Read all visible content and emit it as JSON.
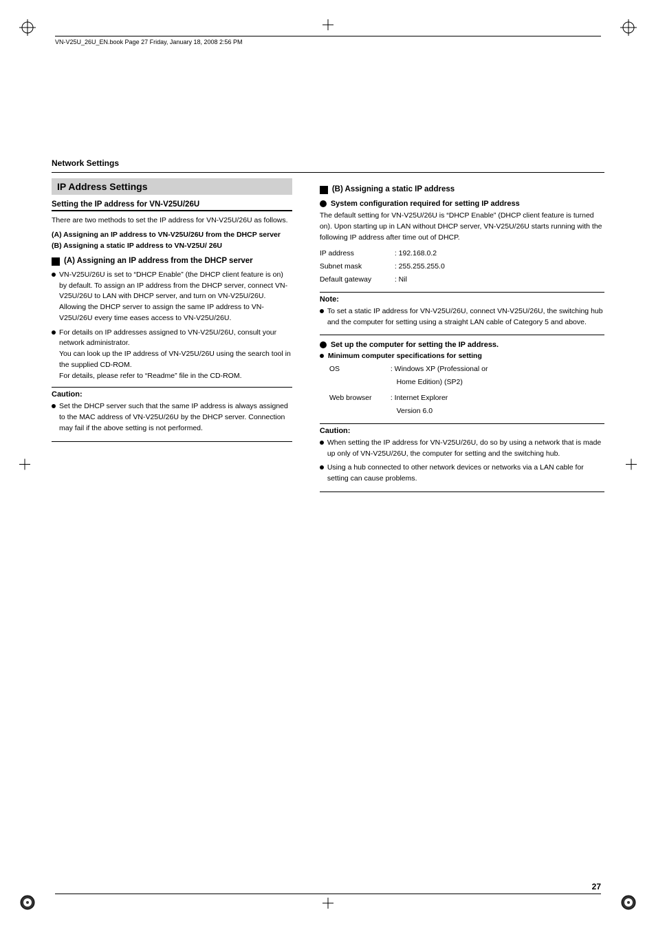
{
  "page": {
    "number": "27",
    "file_info": "VN-V25U_26U_EN.book  Page 27  Friday, January 18, 2008  2:56 PM"
  },
  "network_settings": {
    "section_heading": "Network Settings",
    "ip_address_box_title": "IP Address Settings",
    "subsection_title": "Setting the IP address for VN-V25U/26U",
    "intro_text": "There are two methods to set the IP address for VN-V25U/26U as follows.",
    "list_a_bold": "(A) Assigning an IP address to VN-V25U/26U from the DHCP server",
    "list_b_bold": "(B) Assigning a static IP address to VN-V25U/\n26U",
    "section_a_heading": "(A) Assigning an IP address from the DHCP server",
    "section_a_bullets": [
      "VN-V25U/26U is set to “DHCP Enable” (the DHCP client feature is on) by default. To assign an IP address from the DHCP server, connect VN-V25U/26U to LAN with DHCP server, and turn on VN-V25U/26U. Allowing the DHCP server to assign the same IP address to VN-V25U/26U every time eases access to VN-V25U/26U.",
      "For details on IP addresses assigned to VN-V25U/26U, consult your network administrator.\nYou can look up the IP address of VN-V25U/26U using the search tool in the supplied CD-ROM.\nFor details, please refer to “Readme” file in the CD-ROM."
    ],
    "caution_title": "Caution:",
    "caution_left_bullets": [
      "Set the DHCP server such that the same IP address is always assigned to the MAC address of VN-V25U/26U by the DHCP server. Connection may fail if the above setting is not performed."
    ],
    "section_b_heading": "(B) Assigning a static IP address",
    "system_config_heading": "System configuration required for setting IP address",
    "system_config_body": "The default setting for VN-V25U/26U is “DHCP Enable” (DHCP client feature is turned on). Upon starting up in LAN without DHCP server, VN-V25U/26U starts running with the following IP address after time out of DHCP.",
    "ip_table": {
      "ip_address_label": "IP address",
      "ip_address_value": ": 192.168.0.2",
      "subnet_mask_label": "Subnet mask",
      "subnet_mask_value": ": 255.255.255.0",
      "default_gateway_label": "Default gateway",
      "default_gateway_value": ": Nil"
    },
    "note_title": "Note:",
    "note_bullets": [
      "To set a static IP address for VN-V25U/26U, connect VN-V25U/26U, the switching hub and the computer for setting using a straight LAN cable of Category 5 and above."
    ],
    "setup_computer_heading": "Set up the computer for setting the IP address.",
    "min_spec_heading": "Minimum computer specifications for setting",
    "os_label": "OS",
    "os_value": ": Windows XP (Professional or Home Edition) (SP2)",
    "web_browser_label": "Web browser",
    "web_browser_value": ": Internet Explorer",
    "web_browser_value2": "Version 6.0",
    "caution_right_title": "Caution:",
    "caution_right_bullets": [
      "When setting the IP address for VN-V25U/26U, do so by using a network that is made up only of VN-V25U/26U, the computer for setting and the switching hub.",
      "Using a hub connected to other network devices or networks via a LAN cable for setting can cause problems."
    ]
  }
}
